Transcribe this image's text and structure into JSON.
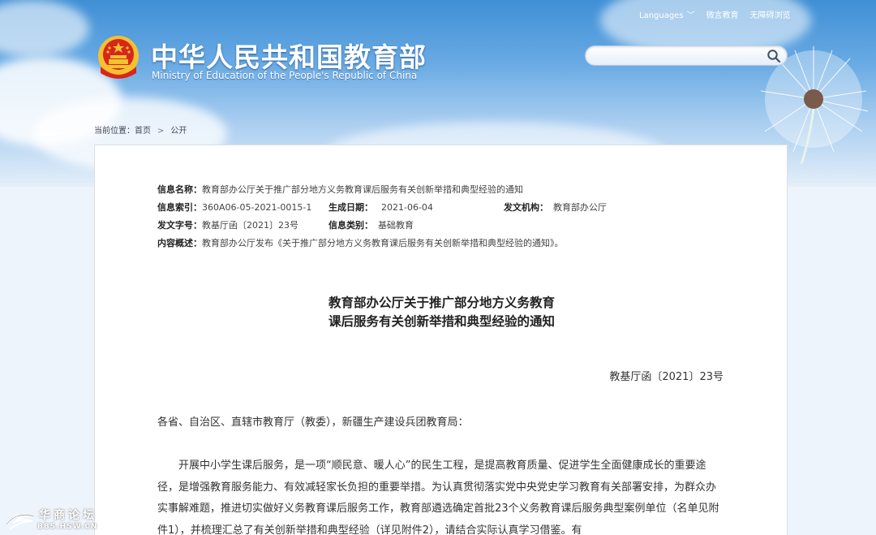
{
  "header": {
    "top_links": [
      "Languages",
      "微言教育",
      "无障碍浏览"
    ],
    "site_title": "中华人民共和国教育部",
    "site_subtitle": "Ministry of Education of the People's Republic of China",
    "search": {
      "placeholder": ""
    }
  },
  "breadcrumb": {
    "label": "当前位置：",
    "items": [
      "首页",
      "公开"
    ]
  },
  "meta": {
    "name_label": "信息名称：",
    "name_value": "教育部办公厅关于推广部分地方义务教育课后服务有关创新举措和典型经验的通知",
    "index_label": "信息索引：",
    "index_value": "360A06-05-2021-0015-1",
    "date_label": "生成日期：",
    "date_value": "2021-06-04",
    "issuer_label": "发文机构：",
    "issuer_value": "教育部办公厅",
    "docno_label": "发文字号：",
    "docno_value": "教基厅函〔2021〕23号",
    "category_label": "信息类别：",
    "category_value": "基础教育",
    "summary_label": "内容概述：",
    "summary_value": "教育部办公厅发布《关于推广部分地方义务教育课后服务有关创新举措和典型经验的通知》。"
  },
  "document": {
    "title_line1": "教育部办公厅关于推广部分地方义务教育",
    "title_line2": "课后服务有关创新举措和典型经验的通知",
    "doc_number": "教基厅函〔2021〕23号",
    "salutation": "各省、自治区、直辖市教育厅（教委），新疆生产建设兵团教育局：",
    "paragraph1": "开展中小学生课后服务，是一项“顺民意、暖人心”的民生工程，是提高教育质量、促进学生全面健康成长的重要途径，是增强教育服务能力、有效减轻家长负担的重要举措。为认真贯彻落实党中央党史学习教育有关部署安排，为群众办实事解难题，推进切实做好义务教育课后服务工作，教育部遴选确定首批23个义务教育课后服务典型案例单位（名单见附件1），并梳理汇总了有关创新举措和典型经验（详见附件2），请结合实际认真学习借鉴。有"
  },
  "watermark": {
    "line1": "华商论坛",
    "line2": "BBS.HSW.CN"
  },
  "colors": {
    "sky_top": "#3f8fd6",
    "panel_bg": "#ffffff",
    "emblem_red": "#d8261c",
    "emblem_gold": "#f2c230"
  }
}
